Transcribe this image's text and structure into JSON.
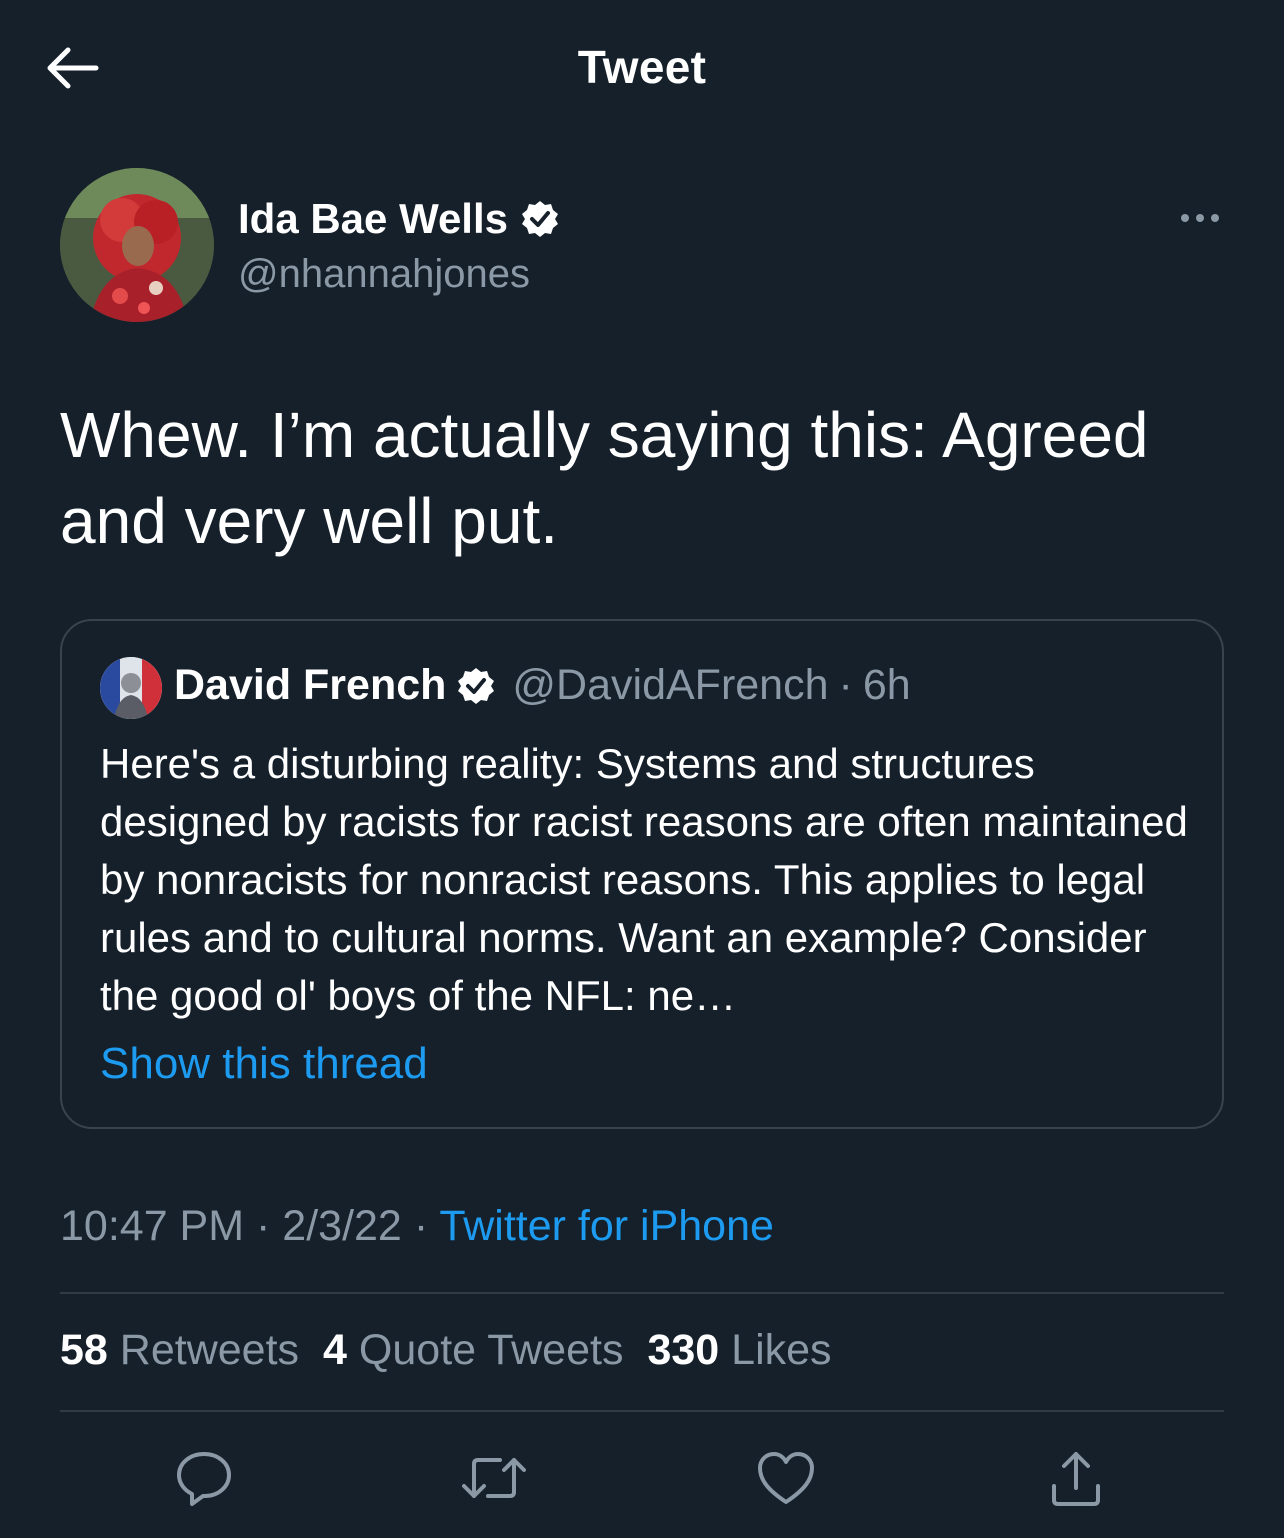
{
  "header": {
    "title": "Tweet",
    "back_icon": "arrow-left-icon"
  },
  "author": {
    "name": "Ida Bae Wells",
    "handle": "@nhannahjones",
    "verified": true
  },
  "tweet": {
    "text": "Whew. I’m actually saying this: Agreed and very well put."
  },
  "quoted_tweet": {
    "name": "David French",
    "handle": "@DavidAFrench",
    "time_sep": "·",
    "time": "6h",
    "verified": true,
    "text": "Here's a disturbing reality: Systems and structures designed by racists for racist reasons are often maintained by nonracists for nonracist reasons. This applies to legal rules and to cultural norms. Want an example? Consider the good ol' boys of the NFL: ne…",
    "show_thread_label": "Show this thread"
  },
  "meta": {
    "time": "10:47 PM",
    "sep1": "·",
    "date": "2/3/22",
    "sep2": "·",
    "source": "Twitter for iPhone"
  },
  "stats": {
    "retweets_count": "58",
    "retweets_label": "Retweets",
    "quotes_count": "4",
    "quotes_label": "Quote Tweets",
    "likes_count": "330",
    "likes_label": "Likes"
  },
  "actions": [
    "reply-icon",
    "retweet-icon",
    "like-icon",
    "share-icon"
  ],
  "colors": {
    "background": "#15202b",
    "text": "#ffffff",
    "secondary": "#8b98a5",
    "accent": "#1d9bf0",
    "border": "#38444d"
  }
}
